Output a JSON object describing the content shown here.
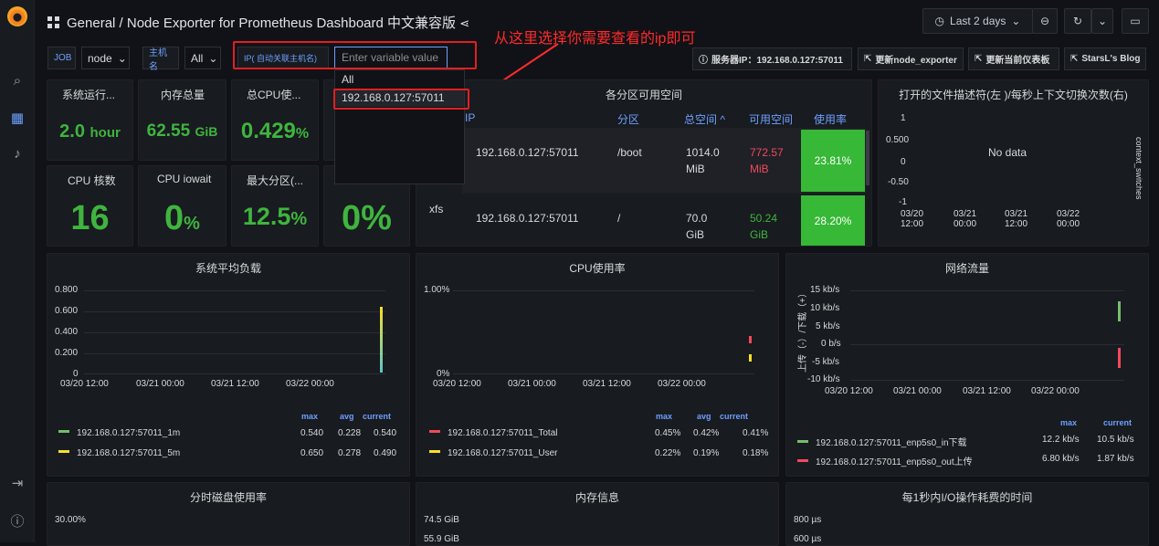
{
  "header": {
    "title": "General / Node Exporter for Prometheus Dashboard 中文兼容版",
    "time_range": "Last 2 days"
  },
  "annotation": "从这里选择你需要查看的ip即可",
  "variables": {
    "job_label": "JOB",
    "job_value": "node",
    "host_label": "主机名",
    "host_value": "All",
    "ip_label": "IP( 自动关联主机名)",
    "ip_placeholder": "Enter variable value"
  },
  "dropdown": [
    "All",
    "192.168.0.127:57011"
  ],
  "links": [
    "服务器IP：192.168.0.127:57011",
    "更新node_exporter",
    "更新当前仪表板",
    "StarsL's Blog"
  ],
  "stats": [
    {
      "title": "系统运行...",
      "value": "2.0",
      "unit": "hour"
    },
    {
      "title": "内存总量",
      "value": "62.55",
      "unit": "GiB"
    },
    {
      "title": "总CPU使...",
      "value": "0.429",
      "unit": "%"
    },
    {
      "title": "CPU 核数",
      "value": "16",
      "unit": ""
    },
    {
      "title": "CPU iowait",
      "value": "0",
      "unit": "%"
    },
    {
      "title": "最大分区(...",
      "value": "12.5",
      "unit": "%"
    },
    {
      "title": "",
      "value": "0%",
      "unit": ""
    }
  ],
  "disk_table": {
    "title": "各分区可用空间",
    "headers": [
      "IP",
      "分区",
      "总空间 ^",
      "可用空间",
      "使用率"
    ],
    "rows": [
      {
        "fs": "",
        "ip": "192.168.0.127:57011",
        "part": "/boot",
        "total": "1014.0",
        "total_unit": "MiB",
        "avail": "772.57",
        "avail_unit": "MiB",
        "pct": "23.81%"
      },
      {
        "fs": "xfs",
        "ip": "192.168.0.127:57011",
        "part": "/",
        "total": "70.0",
        "total_unit": "GiB",
        "avail": "50.24",
        "avail_unit": "GiB",
        "pct": "28.20%"
      }
    ]
  },
  "fd_panel": {
    "title": "打开的文件描述符(左 )/每秒上下文切换次数(右)",
    "nodata": "No data",
    "y_ticks": [
      "1",
      "0.500",
      "0",
      "-0.50",
      "-1"
    ],
    "x_ticks": [
      "03/20\n12:00",
      "03/21\n00:00",
      "03/21\n12:00",
      "03/22\n00:00"
    ],
    "right_label": "context_switches"
  },
  "load_panel": {
    "title": "系统平均负载",
    "y_ticks": [
      "0.800",
      "0.600",
      "0.400",
      "0.200",
      "0"
    ],
    "x_ticks": [
      "03/20 12:00",
      "03/21 00:00",
      "03/21 12:00",
      "03/22 00:00"
    ],
    "legend_headers": [
      "max",
      "avg",
      "current"
    ],
    "legend": [
      {
        "name": "192.168.0.127:57011_1m",
        "max": "0.540",
        "avg": "0.228",
        "cur": "0.540",
        "color": "#73bf69"
      },
      {
        "name": "192.168.0.127:57011_5m",
        "max": "0.650",
        "avg": "0.278",
        "cur": "0.490",
        "color": "#fade2a"
      }
    ]
  },
  "cpu_panel": {
    "title": "CPU使用率",
    "y_ticks": [
      "1.00%",
      "0%"
    ],
    "x_ticks": [
      "03/20 12:00",
      "03/21 00:00",
      "03/21 12:00",
      "03/22 00:00"
    ],
    "legend_headers": [
      "max",
      "avg",
      "current"
    ],
    "legend": [
      {
        "name": "192.168.0.127:57011_Total",
        "max": "0.45%",
        "avg": "0.42%",
        "cur": "0.41%",
        "color": "#f2495c"
      },
      {
        "name": "192.168.0.127:57011_User",
        "max": "0.22%",
        "avg": "0.19%",
        "cur": "0.18%",
        "color": "#fade2a"
      }
    ]
  },
  "net_panel": {
    "title": "网络流量",
    "y_ticks": [
      "15 kb/s",
      "10 kb/s",
      "5 kb/s",
      "0 b/s",
      "-5 kb/s",
      "-10 kb/s"
    ],
    "x_ticks": [
      "03/20 12:00",
      "03/21 00:00",
      "03/21 12:00",
      "03/22 00:00"
    ],
    "y_label": "上传（-）/下载（+）",
    "legend_headers": [
      "max",
      "current"
    ],
    "legend": [
      {
        "name": "192.168.0.127:57011_enp5s0_in下载",
        "max": "12.2 kb/s",
        "cur": "10.5 kb/s",
        "color": "#73bf69"
      },
      {
        "name": "192.168.0.127:57011_enp5s0_out上传",
        "max": "6.80 kb/s",
        "cur": "1.87 kb/s",
        "color": "#f2495c"
      }
    ]
  },
  "bottom": [
    {
      "title": "分时磁盘使用率",
      "y": "30.00%"
    },
    {
      "title": "内存信息",
      "y": "74.5 GiB",
      "y2": "55.9 GiB"
    },
    {
      "title": "每1秒内I/O操作耗费的时间",
      "y": "800 µs",
      "y2": "600 µs"
    }
  ]
}
